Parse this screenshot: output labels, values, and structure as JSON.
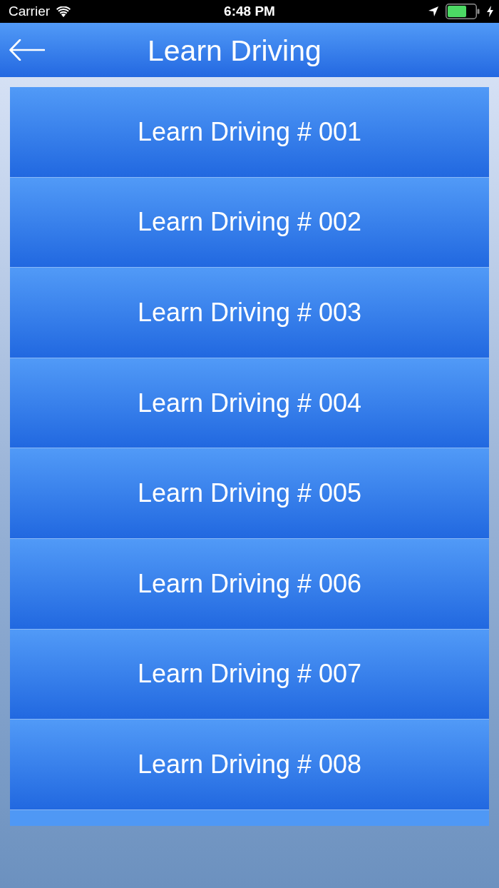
{
  "status_bar": {
    "carrier": "Carrier",
    "time": "6:48 PM"
  },
  "nav_bar": {
    "title": "Learn Driving"
  },
  "list": {
    "items": [
      {
        "label": "Learn Driving # 001"
      },
      {
        "label": "Learn Driving # 002"
      },
      {
        "label": "Learn Driving # 003"
      },
      {
        "label": "Learn Driving # 004"
      },
      {
        "label": "Learn Driving # 005"
      },
      {
        "label": "Learn Driving # 006"
      },
      {
        "label": "Learn Driving # 007"
      },
      {
        "label": "Learn Driving # 008"
      }
    ]
  }
}
